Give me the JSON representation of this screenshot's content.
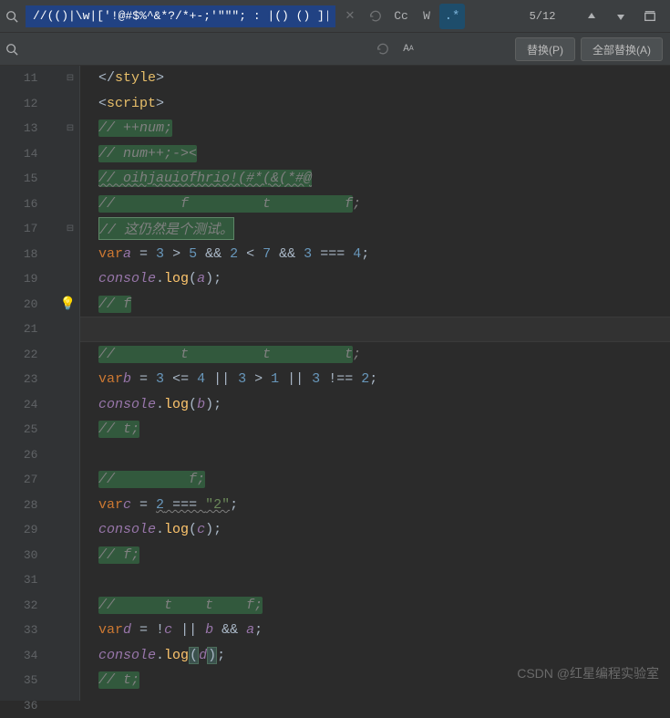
{
  "find": {
    "query": "//(()|\\w|['!@#$%^&*?/*+-;'\"\"\"; : |() () ]|\\S)*$",
    "results": "5/12"
  },
  "replace": {
    "value": ""
  },
  "buttons": {
    "replace_one": "替换(P)",
    "replace_all": "全部替换(A)"
  },
  "watermark": "CSDN @红星编程实验室",
  "lines": {
    "start": 11,
    "end": 36
  },
  "tokens": {
    "style_close_open": "</",
    "style_tag": "style",
    "style_close_end": ">",
    "script_open": "<",
    "script_tag": "script",
    "script_end": ">",
    "var_kw": "var",
    "console": "console",
    "log": "log",
    "a": "a",
    "b": "b",
    "c": "c",
    "d": "d",
    "eq": " = ",
    "num3": "3",
    "num5": "5",
    "num2": "2",
    "num7": "7",
    "num4": "4",
    "num1": "1",
    "str2": "\"2\"",
    "gt": " > ",
    "lt": " < ",
    "and": " && ",
    "or": " || ",
    "teq": " === ",
    "lte": " <= ",
    "tneq": " !== ",
    "not": "!",
    "semi": ";",
    "lparen": "(",
    "rparen": ")",
    "dot": "."
  },
  "comments": {
    "c13": "// ++num;",
    "c14": "// num++;-><",
    "c15": "// oihjauiofhrio!(#*(&(*#@",
    "c16_a": "//        f         t         f",
    "c16_b": ";",
    "c17": "// 这仍然是个测试。",
    "c20": "// f",
    "c22_a": "//        t         t         t",
    "c22_b": ";",
    "c25": "// t;",
    "c27": "//         f;",
    "c30": "// f;",
    "c32": "//      t    t    f;",
    "c35": "// t;"
  }
}
